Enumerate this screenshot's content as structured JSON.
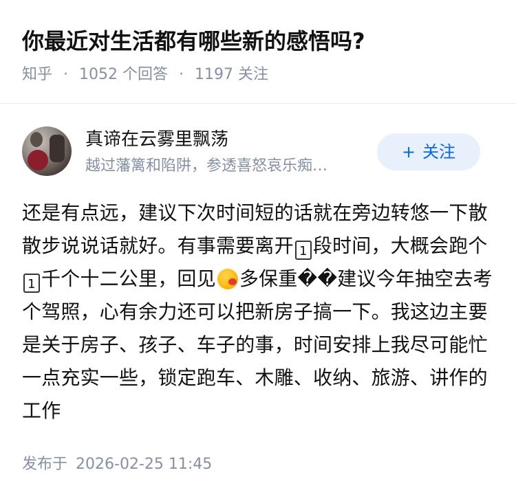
{
  "question": {
    "title": "你最近对生活都有哪些新的感悟吗?",
    "source": "知乎",
    "answer_count": "1052",
    "answer_label": "个回答",
    "follower_count": "1197",
    "follower_label": "关注",
    "separator": "·"
  },
  "author": {
    "name": "真谛在云雾里飘荡",
    "bio": "越过藩篱和陷阱，参透喜怒哀乐痴…",
    "follow_plus": "+",
    "follow_label": "关注",
    "avatar_icon": "avatar-photo"
  },
  "answer": {
    "part1": "还是有点远，建议下次时间短的话就在旁边转悠一下散散步说说话就好。有事需要离开",
    "box1": "1",
    "part2": "段时间，大概会跑个",
    "box2": "1",
    "part3": "千个十二公里，回见",
    "emoji": "kissing-face-emoji",
    "part4": "多保重",
    "missing_glyphs": "��",
    "part5": "建议今年抽空去考个驾照，心有余力还可以把新房子搞一下。我这边主要是关于房子、孩子、车子的事，时间安排上我尽可能忙一点充实一些，锁定跑车、木雕、收纳、旅游、讲作的工作"
  },
  "publish": {
    "label": "发布于",
    "datetime": "2026-02-25 11:45"
  },
  "colors": {
    "meta_gray": "#8590a6",
    "follow_bg": "#e8f0fc",
    "follow_text": "#0066ff",
    "text": "#121212"
  }
}
